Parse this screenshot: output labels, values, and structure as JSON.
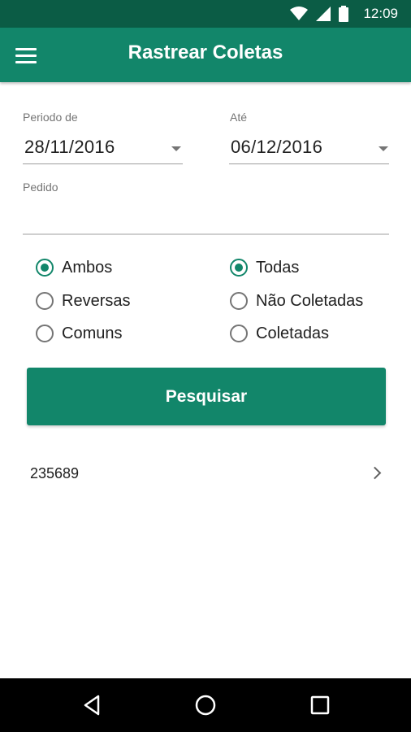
{
  "status_bar": {
    "time": "12:09",
    "icons": [
      "wifi-icon",
      "signal-icon",
      "battery-icon"
    ]
  },
  "app_bar": {
    "title": "Rastrear Coletas",
    "menu_icon": "hamburger-menu-icon"
  },
  "form": {
    "periodo_label": "Periodo de",
    "periodo_value": "28/11/2016",
    "ate_label": "Até",
    "ate_value": "06/12/2016",
    "pedido_label": "Pedido",
    "pedido_value": ""
  },
  "radio_left": [
    {
      "label": "Ambos",
      "checked": true
    },
    {
      "label": "Reversas",
      "checked": false
    },
    {
      "label": "Comuns",
      "checked": false
    }
  ],
  "radio_right": [
    {
      "label": "Todas",
      "checked": true
    },
    {
      "label": "Não Coletadas",
      "checked": false
    },
    {
      "label": "Coletadas",
      "checked": false
    }
  ],
  "search_button": "Pesquisar",
  "results": [
    {
      "id": "235689"
    }
  ],
  "nav_bar": [
    "back-icon",
    "home-icon",
    "recents-icon"
  ],
  "colors": {
    "primary": "#12866a",
    "status_bar": "#0b5c45"
  }
}
